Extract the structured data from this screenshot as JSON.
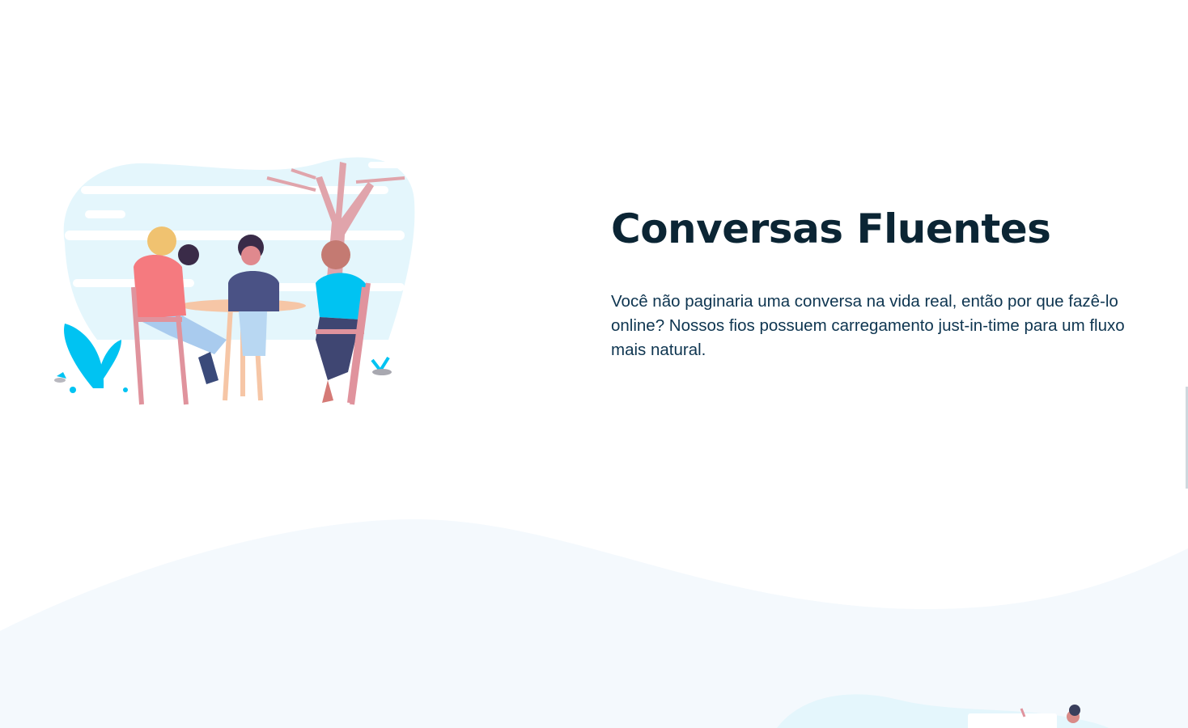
{
  "feature": {
    "title": "Conversas Fluentes",
    "description": "Você não paginaria uma conversa na vida real, então por que fazê-lo online? Nossos fios possuem carregamento just-in-time para um fluxo mais natural."
  },
  "colors": {
    "title": "#0b2534",
    "text": "#0e3550",
    "accent": "#00c3f2",
    "blob": "#e4f6fc",
    "wave": "#f4f9fd"
  },
  "icons": {
    "hero": "people-at-table-illustration",
    "bottom": "person-at-desk-illustration"
  }
}
